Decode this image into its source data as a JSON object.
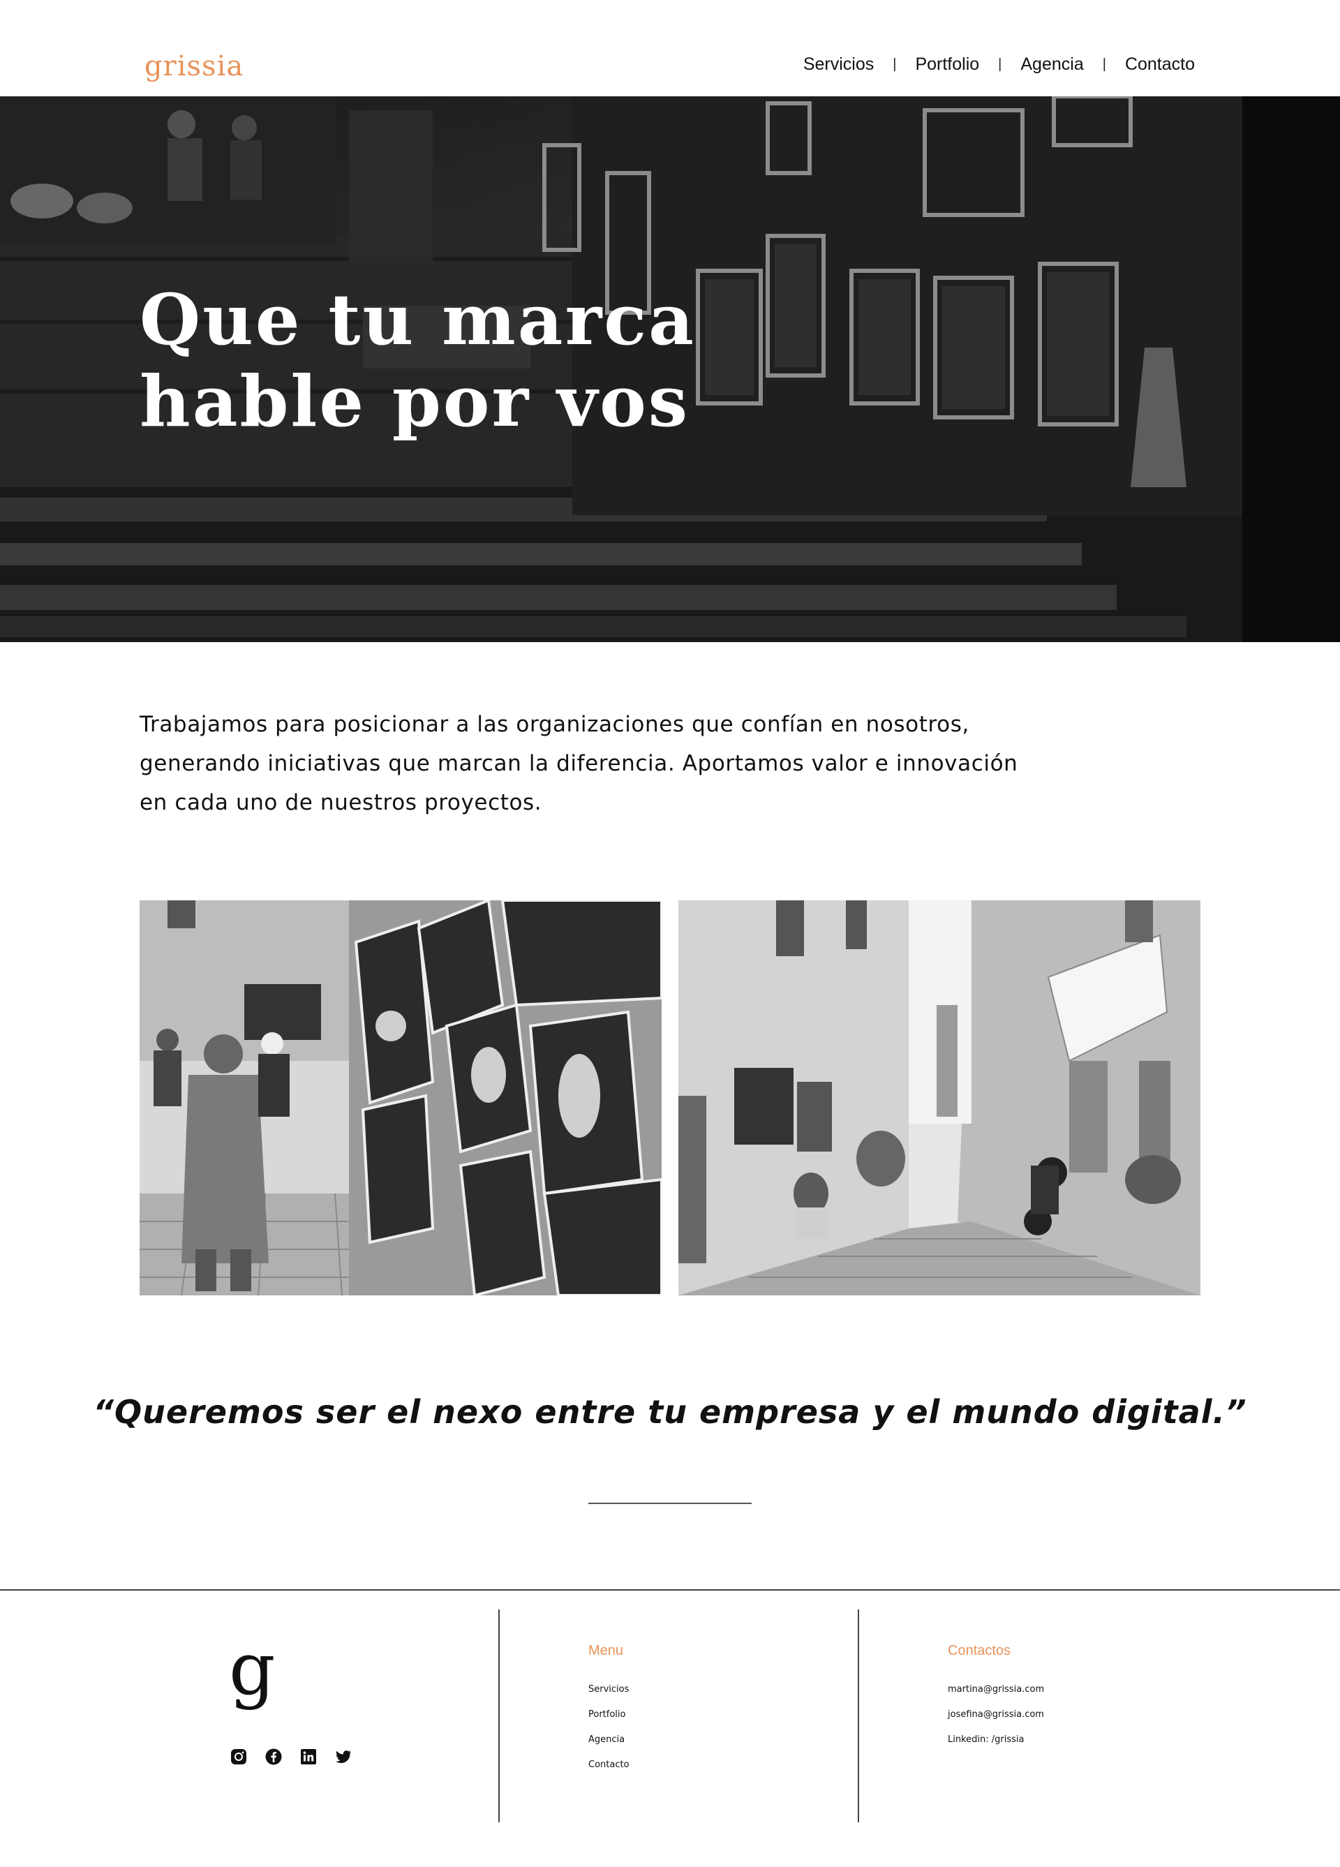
{
  "brand": {
    "logo_text": "grissia",
    "accent_color": "#e8935a"
  },
  "nav": {
    "items": [
      "Servicios",
      "Portfolio",
      "Agencia",
      "Contacto"
    ],
    "separator": "|"
  },
  "hero": {
    "title": "Que tu marca\nhable por vos"
  },
  "intro": {
    "text": "Trabajamos para posicionar a las organizaciones que confían en nosotros, generando iniciativas que marcan la diferencia. Aportamos valor e innovación en cada uno de nuestros proyectos."
  },
  "quote": {
    "text": "“Queremos ser el nexo entre tu empresa y el mundo digital.”"
  },
  "footer": {
    "monogram": "g",
    "social_icons": [
      "instagram-icon",
      "facebook-icon",
      "linkedin-icon",
      "twitter-icon"
    ],
    "menu": {
      "title": "Menu",
      "items": [
        "Servicios",
        "Portfolio",
        "Agencia",
        "Contacto"
      ]
    },
    "contacts": {
      "title": "Contactos",
      "items": [
        "martina@grissia.com",
        "josefina@grissia.com",
        "Linkedin: /grissia"
      ]
    }
  }
}
